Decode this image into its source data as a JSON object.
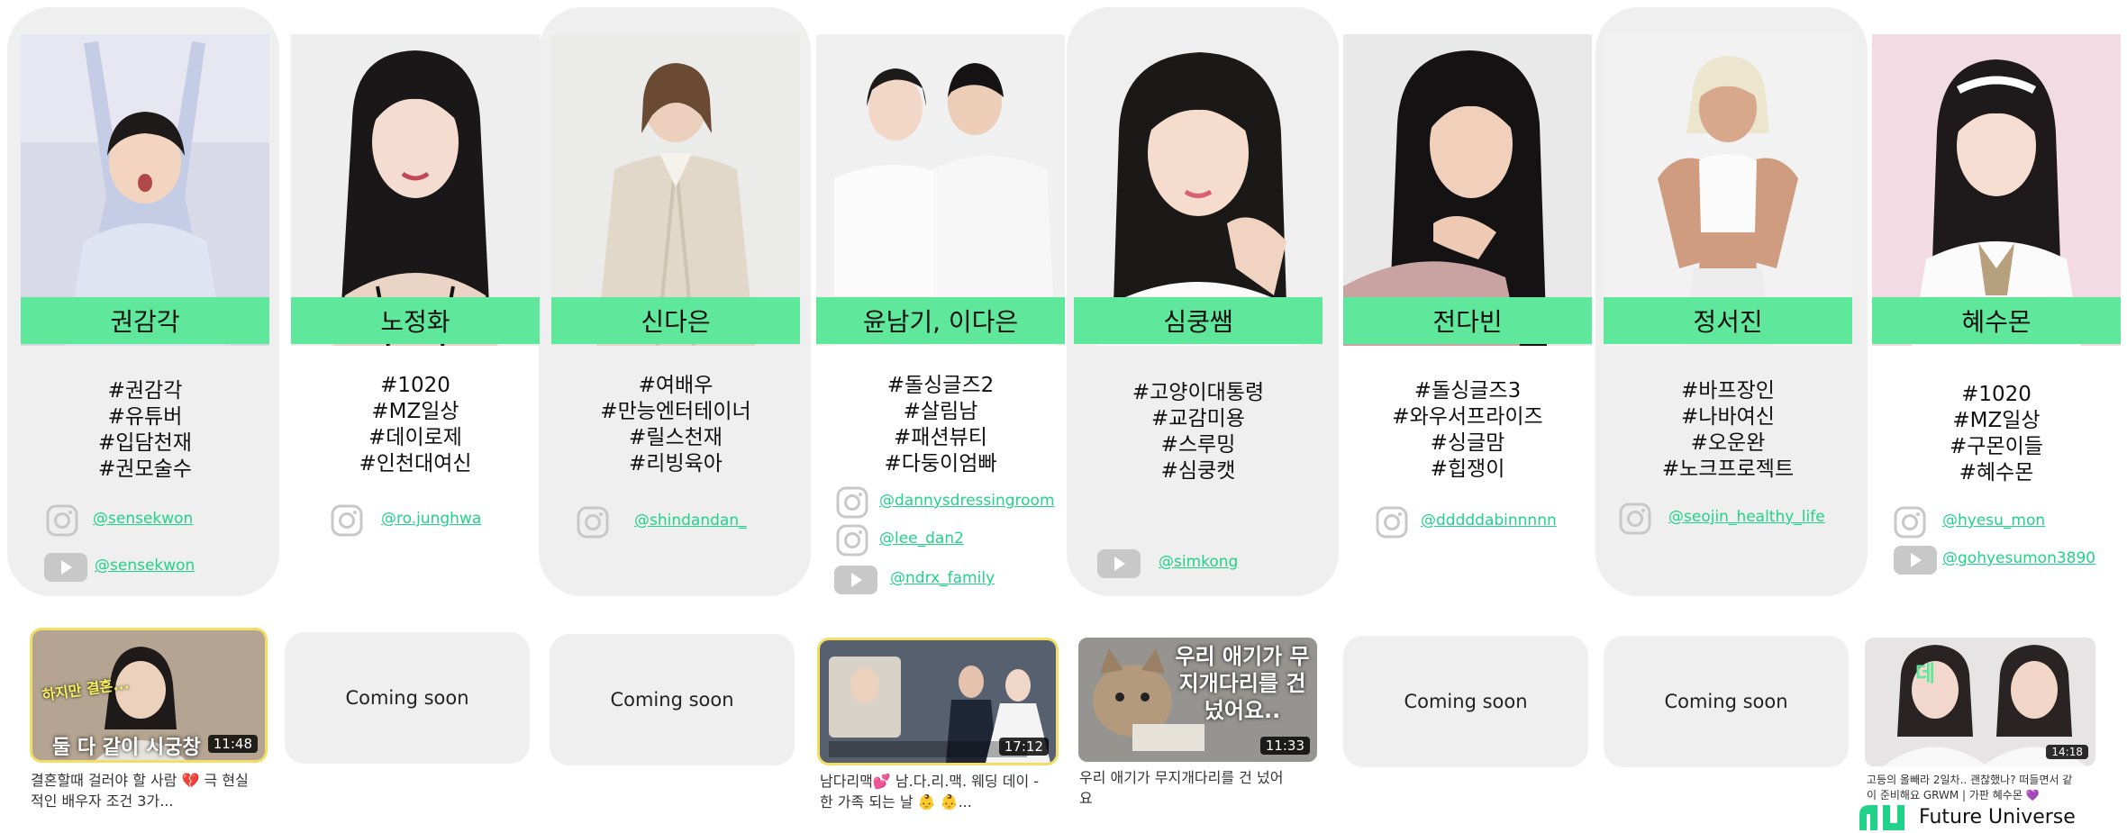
{
  "creators": [
    {
      "name": "권감각",
      "tags": [
        "#권감각",
        "#유튜버",
        "#입담천재",
        "#권모술수"
      ],
      "socials": [
        {
          "icon": "instagram-icon",
          "handle": "@sensekwon"
        },
        {
          "icon": "youtube-icon",
          "handle": "@sensekwon"
        }
      ],
      "video": {
        "status": "video",
        "duration": "11:48",
        "caption": "결혼할때 걸러야 할 사람 💔 극 현실적인 배우자 조건 3가...",
        "overlay_text": "둘 다 같이 시궁창",
        "overlay_small": "하지만 결혼..."
      }
    },
    {
      "name": "노정화",
      "tags": [
        "#1020",
        "#MZ일상",
        "#데이로제",
        "#인천대여신"
      ],
      "socials": [
        {
          "icon": "instagram-icon",
          "handle": "@ro.junghwa"
        }
      ],
      "video": {
        "status": "coming_soon",
        "label": "Coming soon"
      }
    },
    {
      "name": "신다은",
      "tags": [
        "#여배우",
        "#만능엔터테이너",
        "#릴스천재",
        "#리빙육아"
      ],
      "socials": [
        {
          "icon": "instagram-icon",
          "handle": "@shindandan_"
        }
      ],
      "video": {
        "status": "coming_soon",
        "label": "Coming soon"
      }
    },
    {
      "name": "윤남기, 이다은",
      "tags": [
        "#돌싱글즈2",
        "#살림남",
        "#패션뷰티",
        "#다둥이엄빠"
      ],
      "socials": [
        {
          "icon": "instagram-icon",
          "handle": "@dannysdressingroom"
        },
        {
          "icon": "instagram-icon",
          "handle": "@lee_dan2"
        },
        {
          "icon": "youtube-icon",
          "handle": "@ndrx_family"
        }
      ],
      "video": {
        "status": "video",
        "duration": "17:12",
        "caption": "남다리맥💕 남.다.리.맥. 웨딩 데이 - 한 가족 되는 날 👶 👶...",
        "overlay_text": ""
      }
    },
    {
      "name": "심쿵쌤",
      "tags": [
        "#고양이대통령",
        "#교감미용",
        "#스루밍",
        "#심쿵캣"
      ],
      "socials": [
        {
          "icon": "youtube-icon",
          "handle": "@simkong"
        }
      ],
      "video": {
        "status": "video",
        "duration": "11:33",
        "caption": "우리 애기가 무지개다리를 건 넜어요",
        "overlay_text": "우리 애기가 무지개다리를 건넜어요.."
      }
    },
    {
      "name": "전다빈",
      "tags": [
        "#돌싱글즈3",
        "#와우서프라이즈",
        "#싱글맘",
        "#힙쟁이"
      ],
      "socials": [
        {
          "icon": "instagram-icon",
          "handle": "@dddddabinnnnn"
        }
      ],
      "video": {
        "status": "coming_soon",
        "label": "Coming soon"
      }
    },
    {
      "name": "정서진",
      "tags": [
        "#바프장인",
        "#나바여신",
        "#오운완",
        "#노크프로젝트"
      ],
      "socials": [
        {
          "icon": "instagram-icon",
          "handle": "@seojin_healthy_life"
        }
      ],
      "video": {
        "status": "coming_soon",
        "label": "Coming soon"
      }
    },
    {
      "name": "혜수몬",
      "tags": [
        "#1020",
        "#MZ일상",
        "#구몬이들",
        "#혜수몬"
      ],
      "socials": [
        {
          "icon": "instagram-icon",
          "handle": "@hyesu_mon"
        },
        {
          "icon": "youtube-icon",
          "handle": "@gohyesumon3890"
        }
      ],
      "video": {
        "status": "video",
        "duration": "14:18",
        "caption": "고등의 올빼라 2일차.. 괜찮했나? 떠들면서 같이 준비해요 GRWM | 가판 혜수몬 💜",
        "overlay_text": "데"
      }
    }
  ],
  "brand": {
    "logo_text": "Future Universe"
  },
  "colors": {
    "accent": "#5fe89c",
    "link": "#21d38a",
    "card_bg": "#efefef",
    "highlight_border": "#f3dd63"
  }
}
